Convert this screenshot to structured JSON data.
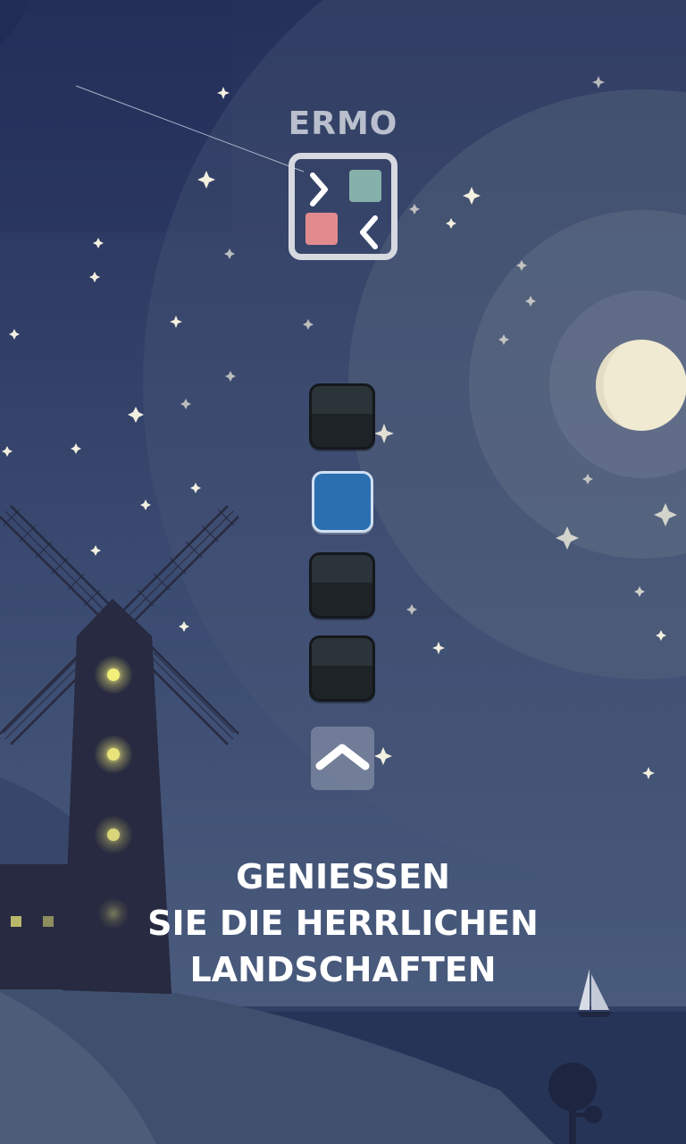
{
  "game": {
    "title": "ERMO",
    "logo": {
      "teal_color": "#86b1aa",
      "pink_color": "#e28b8e",
      "arrows": [
        "chevron-right-icon",
        "chevron-left-icon"
      ]
    },
    "tiles": [
      {
        "state": "dark"
      },
      {
        "state": "active",
        "color": "#2b6fb1"
      },
      {
        "state": "dark"
      },
      {
        "state": "dark"
      }
    ],
    "up_button_icon": "chevron-up-icon"
  },
  "caption": {
    "line1": "GENIESSEN",
    "line2": "SIE DIE HERRLICHEN LANDSCHAFTEN"
  },
  "colors": {
    "sky_top": "#2b3762",
    "sky_bottom": "#4a5a7c",
    "moon": "#f0ead2",
    "window_light": "#f2ee7a",
    "windmill": "#272a40"
  }
}
